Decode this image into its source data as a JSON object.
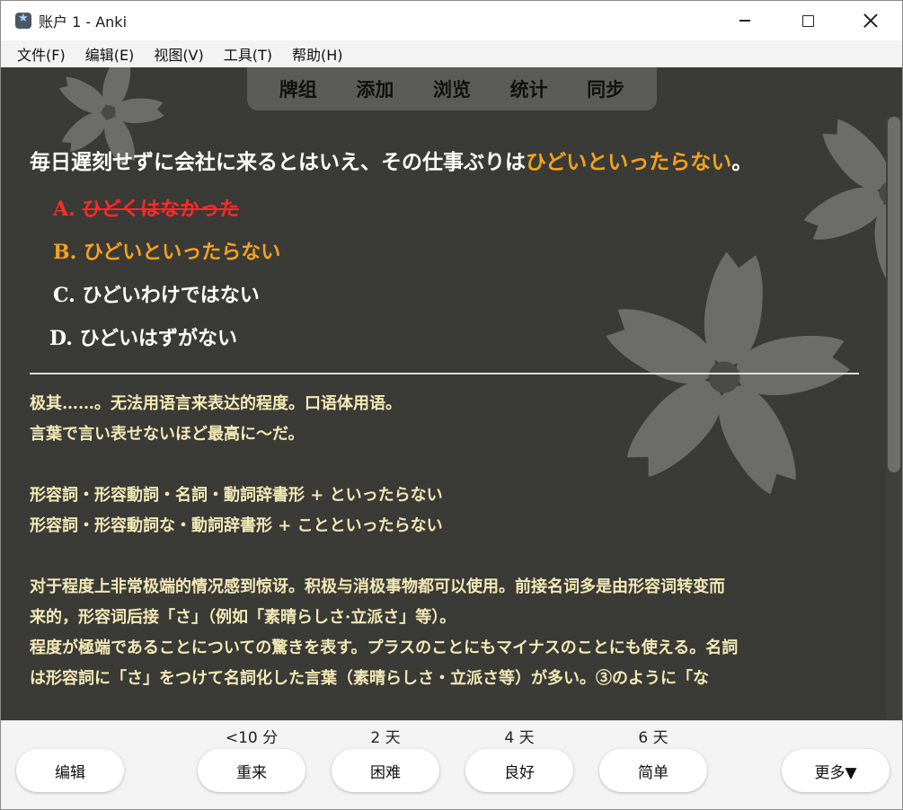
{
  "window": {
    "title": "账户 1 - Anki"
  },
  "menu": [
    "文件(F)",
    "编辑(E)",
    "视图(V)",
    "工具(T)",
    "帮助(H)"
  ],
  "top_nav": [
    "牌组",
    "添加",
    "浏览",
    "统计",
    "同步"
  ],
  "card": {
    "question_prefix": "毎日遅刻せずに会社に来るとはいえ、その仕事ぶりは",
    "question_highlight": "ひどいといったらない",
    "question_suffix": "。",
    "options": [
      {
        "letter": "A.",
        "text": "ひどくはなかった",
        "state": "wrong"
      },
      {
        "letter": "B.",
        "text": "ひどいといったらない",
        "state": "correct"
      },
      {
        "letter": "C.",
        "text": "ひどいわけではない",
        "state": "normal"
      },
      {
        "letter": "D.",
        "text": "ひどいはずがない",
        "state": "normal"
      }
    ],
    "explanation": [
      "极其……。无法用语言来表达的程度。口语体用语。",
      "言葉で言い表せないほど最高に～だ。",
      "",
      "形容詞・形容動詞・名詞・動詞辞書形 + といったらない",
      "形容詞・形容動詞な・動詞辞書形 + ことといったらない",
      "",
      "对于程度上非常极端的情况感到惊讶。积极与消极事物都可以使用。前接名词多是由形容词转变而",
      "来的，形容词后接「さ」（例如「素晴らしさ·立派さ」等）。",
      "程度が極端であることについての驚きを表す。プラスのことにもマイナスのことにも使える。名詞",
      "は形容詞に「さ」をつけて名詞化した言葉（素晴らしさ・立派さ等）が多い。③のように「な"
    ]
  },
  "answer_bar": {
    "edit_label": "编辑",
    "more_label": "更多▼",
    "ease_buttons": [
      {
        "label": "重来",
        "interval": "<10 分"
      },
      {
        "label": "困难",
        "interval": "2 天"
      },
      {
        "label": "良好",
        "interval": "4 天"
      },
      {
        "label": "简单",
        "interval": "6 天"
      }
    ]
  },
  "colors": {
    "card_background": "#3a3a37",
    "highlight": "#f5a31b",
    "wrong": "#ff2a2a",
    "explanation_text": "#f3e9b6"
  },
  "icons": [
    "anki-app-icon",
    "minimize-icon",
    "maximize-icon",
    "close-icon",
    "sakura-flower-background"
  ]
}
